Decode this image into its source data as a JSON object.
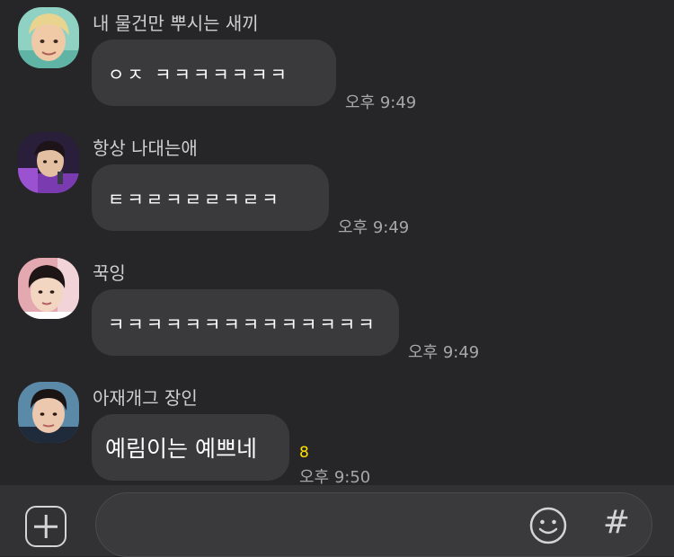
{
  "messages": [
    {
      "sender": "내 물건만 뿌시는 새끼",
      "text": "ㅇㅈ ㅋㅋㅋㅋㅋㅋㅋ",
      "time": "오후 9:49"
    },
    {
      "sender": "항상 나대는애",
      "text": "ㅌㅋㄹㅋㄹㄹㅋㄹㅋ",
      "time": "오후 9:49"
    },
    {
      "sender": "꾹잉",
      "text": "ㅋㅋㅋㅋㅋㅋㅋㅋㅋㅋㅋㅋㅋㅋ",
      "time": "오후 9:49"
    },
    {
      "sender": "아재개그 장인",
      "text": "예림이는 예쁘네",
      "time": "오후 9:50",
      "unread_count": "8"
    }
  ],
  "composer": {
    "add_icon": "plus-square-icon",
    "emoji_icon": "smiley-icon",
    "hash_symbol": "#"
  },
  "colors": {
    "background": "#262628",
    "bubble": "#3a3a3d",
    "unread": "#ffe000",
    "time": "#a7a7a9"
  }
}
